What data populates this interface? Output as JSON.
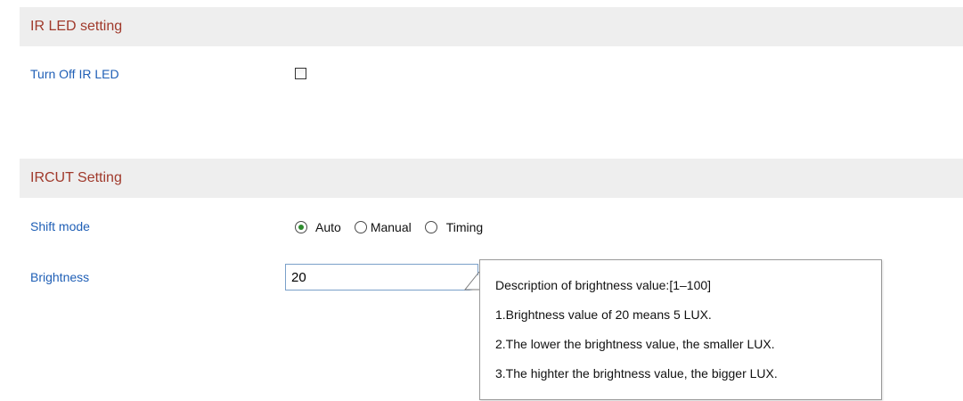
{
  "ir_led": {
    "title": "IR LED setting",
    "turn_off_label": "Turn Off IR LED",
    "turn_off_checked": false
  },
  "ircut": {
    "title": "IRCUT Setting",
    "shift_mode_label": "Shift mode",
    "shift_mode_options": [
      "Auto",
      "Manual",
      "Timing"
    ],
    "shift_mode_selected": "Auto",
    "brightness_label": "Brightness",
    "brightness_value": "20"
  },
  "tooltip": {
    "lines": [
      "Description of brightness value:[1–100]",
      "1.Brightness value of 20 means 5 LUX.",
      "2.The lower the brightness value, the smaller LUX.",
      "3.The highter the brightness value, the bigger LUX."
    ]
  },
  "colors": {
    "header_bg": "#eeeeee",
    "header_text": "#a0392b",
    "label_text": "#1f5fb6",
    "radio_selected": "#2e8b2e"
  }
}
